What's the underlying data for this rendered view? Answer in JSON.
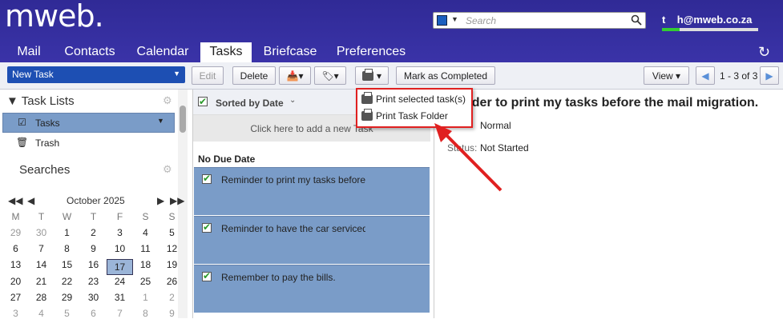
{
  "header": {
    "logo": "mweb.",
    "search_placeholder": "Search",
    "user_email": "t    h@mweb.co.za",
    "tabs": [
      "Mail",
      "Contacts",
      "Calendar",
      "Tasks",
      "Briefcase",
      "Preferences"
    ],
    "active_tab": "Tasks"
  },
  "toolbar": {
    "new_task": "New Task",
    "edit": "Edit",
    "delete": "Delete",
    "mark_completed": "Mark as Completed",
    "view": "View",
    "page_info": "1 - 3 of 3"
  },
  "print_menu": {
    "items": [
      "Print selected task(s)",
      "Print Task Folder"
    ]
  },
  "sidebar": {
    "task_lists": "Task Lists",
    "items": [
      "Tasks",
      "Trash"
    ],
    "searches": "Searches"
  },
  "calendar": {
    "month": "October 2025",
    "weekdays": [
      "M",
      "T",
      "W",
      "T",
      "F",
      "S",
      "S"
    ],
    "weeks": [
      [
        "29",
        "30",
        "1",
        "2",
        "3",
        "4",
        "5"
      ],
      [
        "6",
        "7",
        "8",
        "9",
        "10",
        "11",
        "12"
      ],
      [
        "13",
        "14",
        "15",
        "16",
        "17",
        "18",
        "19"
      ],
      [
        "20",
        "21",
        "22",
        "23",
        "24",
        "25",
        "26"
      ],
      [
        "27",
        "28",
        "29",
        "30",
        "31",
        "1",
        "2"
      ],
      [
        "3",
        "4",
        "5",
        "6",
        "7",
        "8",
        "9"
      ]
    ],
    "today": "17"
  },
  "task_list": {
    "sort_label": "Sorted by Date",
    "add_new": "Click here to add a new Task",
    "group": "No Due Date",
    "tasks": [
      "Reminder to print my tasks before the mail migration.",
      "Reminder to have the car serviced",
      "Remember to pay the bills."
    ]
  },
  "detail": {
    "title": "nder to print my tasks before the mail migration.",
    "priority_value": "Normal",
    "status_label": "Status:",
    "status_value": "Not Started"
  },
  "colors": {
    "header_bg": "#322b9c",
    "selected_row": "#7a9cc8",
    "annotation": "#e02020"
  }
}
